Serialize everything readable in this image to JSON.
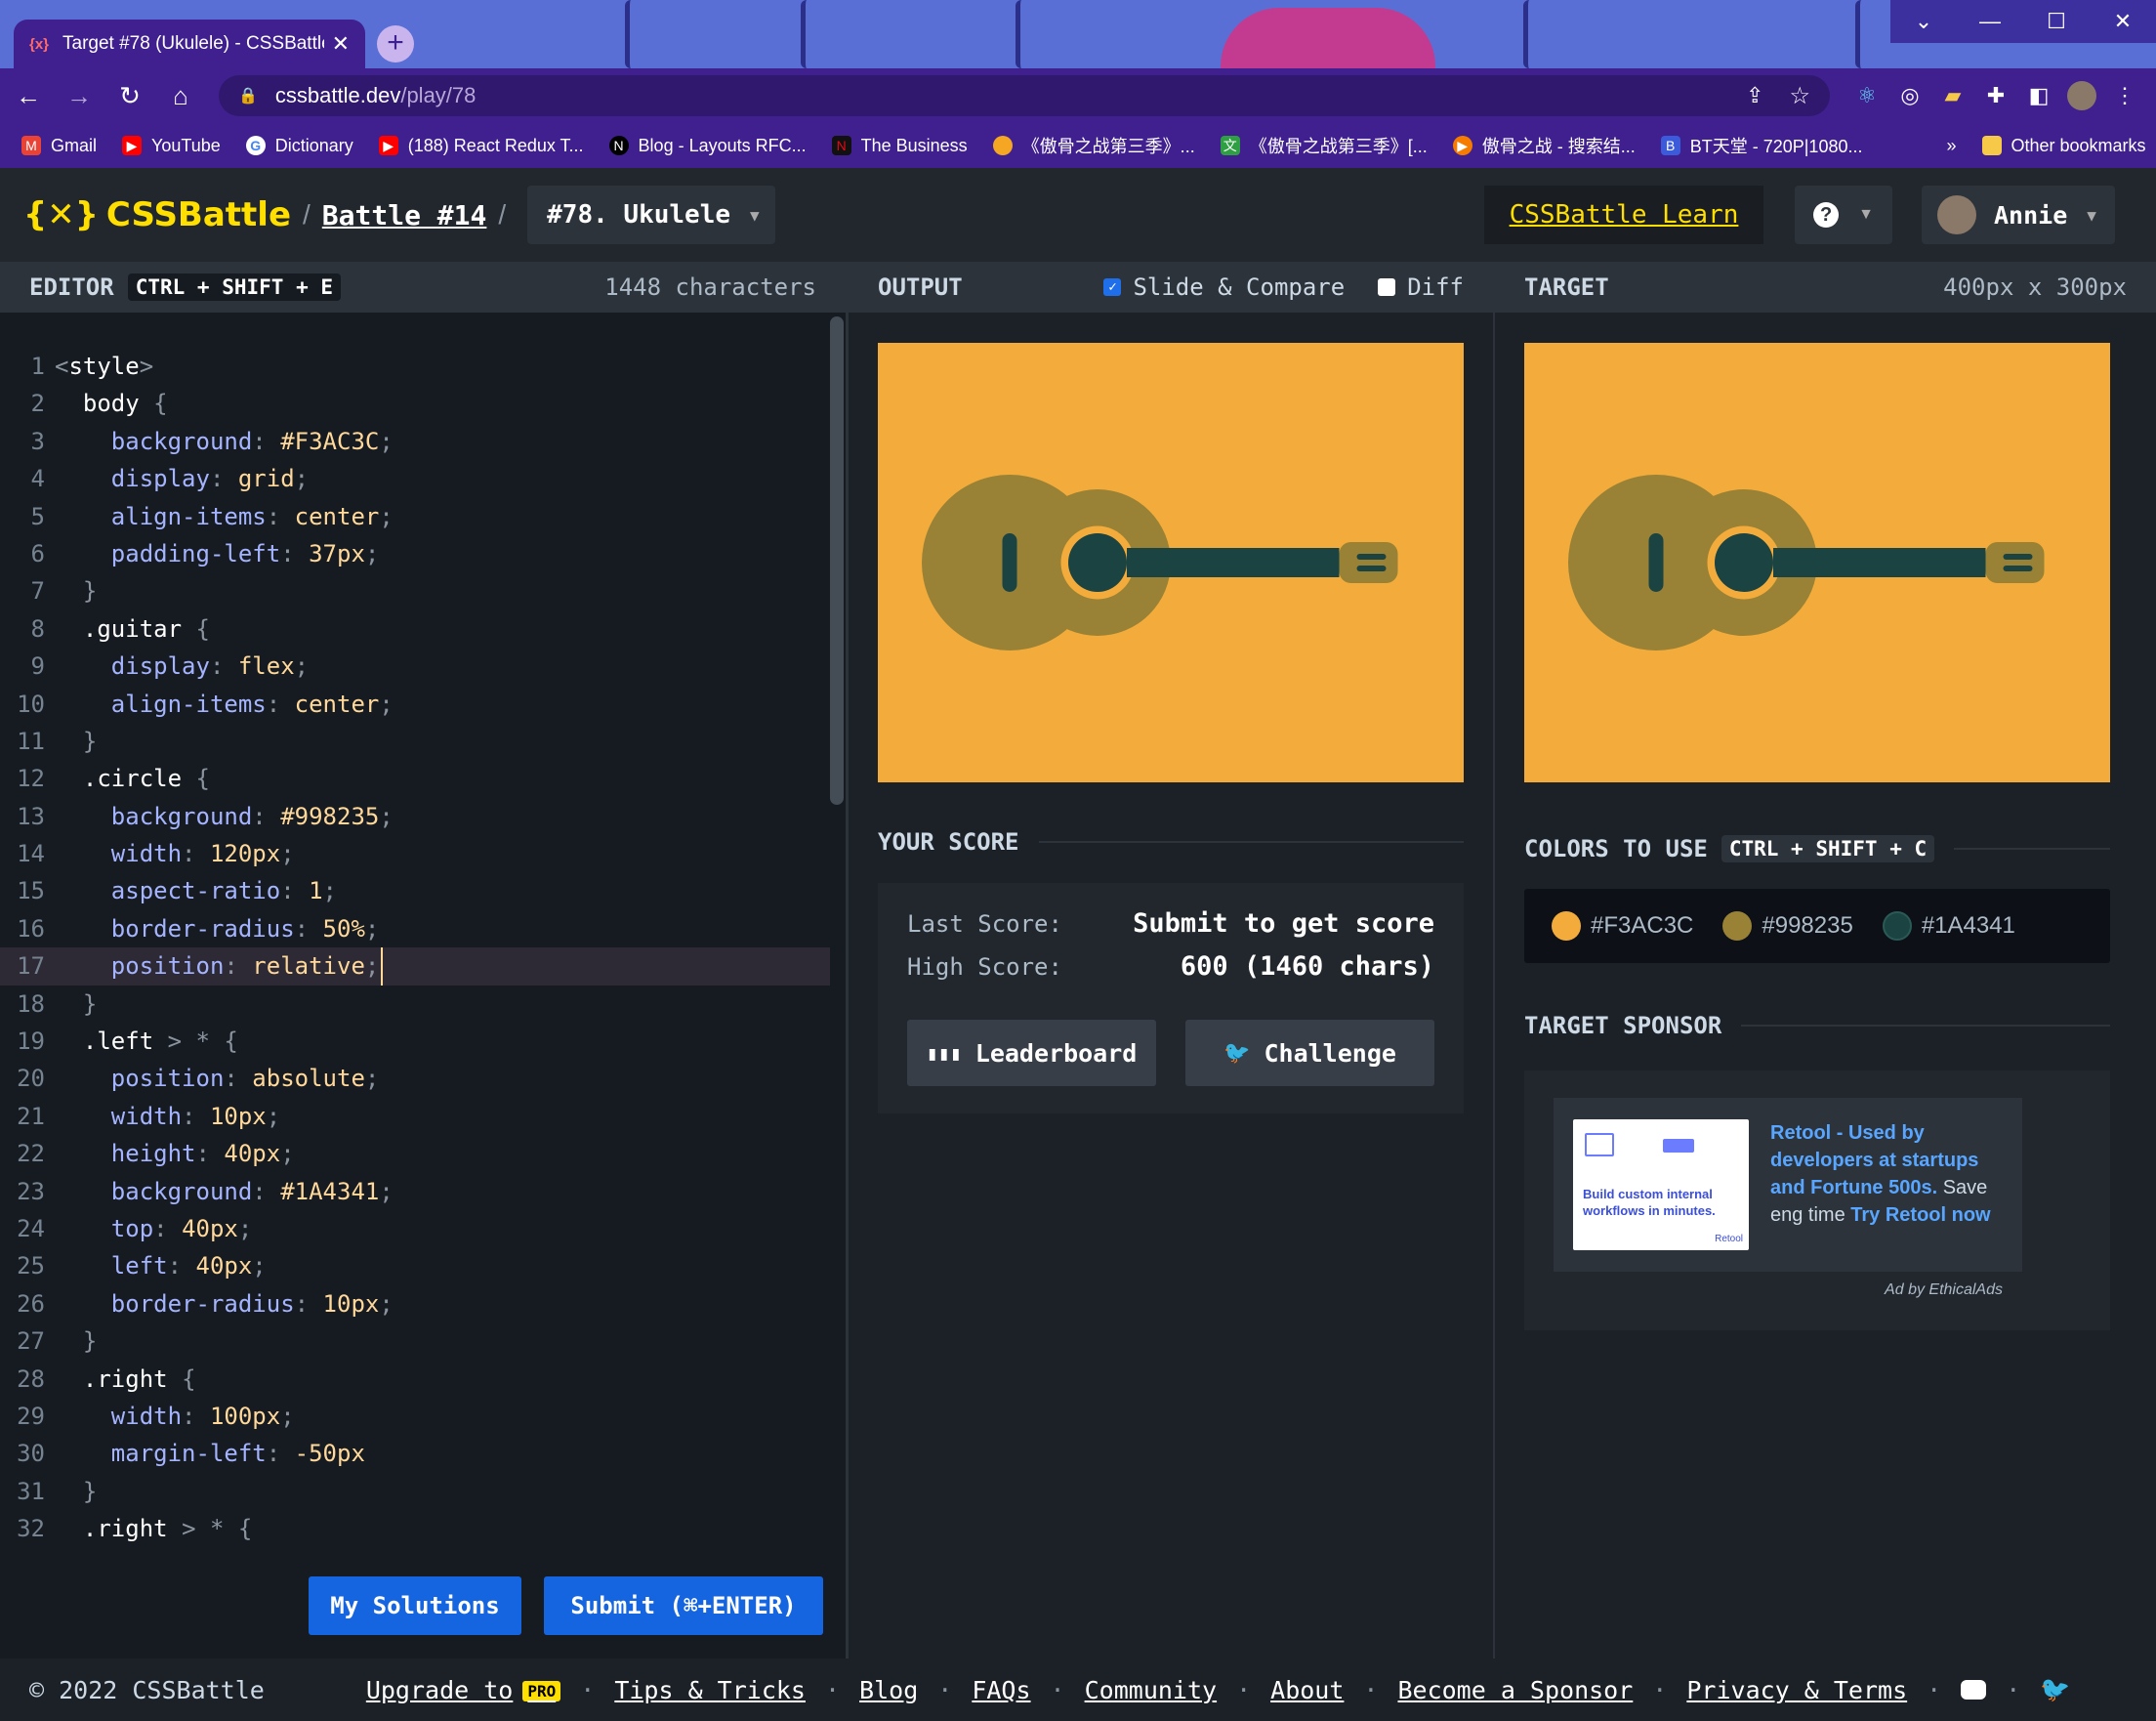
{
  "browser": {
    "tab_title": "Target #78 (Ukulele) - CSSBattle",
    "url_host": "cssbattle.dev",
    "url_path": "/play/78",
    "bookmarks": [
      {
        "label": "Gmail",
        "color": "#ea4335",
        "icon": "gmail-icon"
      },
      {
        "label": "YouTube",
        "color": "#ff0000",
        "icon": "youtube-icon"
      },
      {
        "label": "Dictionary",
        "color": "#4285f4",
        "icon": "google-icon"
      },
      {
        "label": "(188) React Redux T...",
        "color": "#ff0000",
        "icon": "youtube-icon"
      },
      {
        "label": "Blog - Layouts RFC...",
        "color": "#000000",
        "icon": "nextjs-icon"
      },
      {
        "label": "The Business",
        "color": "#111111",
        "icon": "netflix-icon"
      },
      {
        "label": "《傲骨之战第三季》...",
        "color": "#f5a623",
        "icon": "site-icon"
      },
      {
        "label": "《傲骨之战第三季》[...",
        "color": "#2ea043",
        "icon": "site-icon"
      },
      {
        "label": "傲骨之战 - 搜索结...",
        "color": "#f57c00",
        "icon": "site-icon"
      },
      {
        "label": "BT天堂 - 720P|1080...",
        "color": "#3b5bdb",
        "icon": "site-icon"
      }
    ],
    "bookmarks_more": "»",
    "other_bookmarks": "Other bookmarks"
  },
  "header": {
    "logo_text": "CSSBattle",
    "battle": "Battle #14",
    "target": "#78. Ukulele",
    "learn": "CSSBattle Learn",
    "user": "Annie"
  },
  "editor": {
    "title": "EDITOR",
    "shortcut": "CTRL + SHIFT + E",
    "chars": "1448 characters",
    "my_solutions": "My Solutions",
    "submit": "Submit (⌘+ENTER)"
  },
  "output": {
    "title": "OUTPUT",
    "slide_compare": "Slide & Compare",
    "slide_checked": true,
    "diff": "Diff",
    "diff_checked": false
  },
  "score": {
    "title": "YOUR SCORE",
    "last_label": "Last Score:",
    "last_value": "Submit to get score",
    "high_label": "High Score:",
    "high_value": "600 (1460 chars)",
    "leaderboard": "Leaderboard",
    "challenge": "Challenge"
  },
  "target_panel": {
    "title": "TARGET",
    "size": "400px x 300px",
    "colors_title": "COLORS TO USE",
    "colors_shortcut": "CTRL + SHIFT + C",
    "colors": [
      "#F3AC3C",
      "#998235",
      "#1A4341"
    ],
    "sponsor_title": "TARGET SPONSOR",
    "ad_img_line1": "Build custom internal",
    "ad_img_line2": "workflows in minutes.",
    "ad_img_brand": "Retool",
    "ad_head": "Retool - Used by developers at startups and Fortune 500s.",
    "ad_mid": " Save eng time ",
    "ad_cta": "Try Retool now",
    "ad_by": "Ad by EthicalAds"
  },
  "footer": {
    "copyright": "© 2022 CSSBattle",
    "upgrade": "Upgrade to",
    "pro": "PRO",
    "links": [
      "Tips & Tricks",
      "Blog",
      "FAQs",
      "Community",
      "About",
      "Become a Sponsor",
      "Privacy & Terms"
    ]
  }
}
